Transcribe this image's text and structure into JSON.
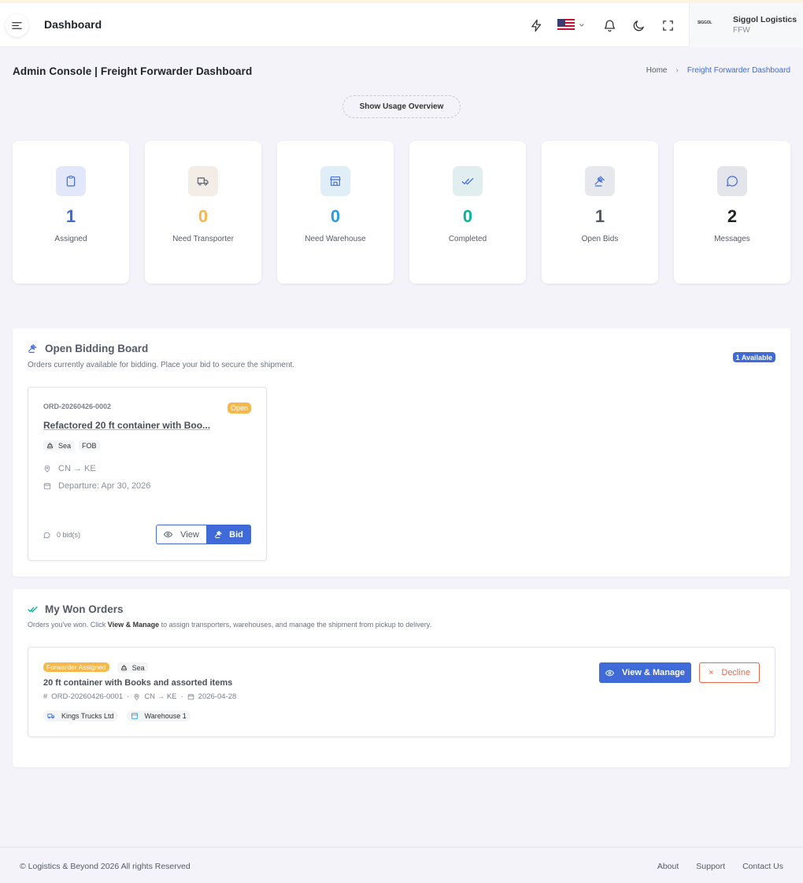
{
  "header": {
    "page_name": "Dashboard",
    "user": {
      "logo_text": "SIGGOL",
      "name": "Siggol Logistics",
      "role": "FFW"
    }
  },
  "title_bar": {
    "title": "Admin Console | Freight Forwarder Dashboard",
    "breadcrumb": {
      "home": "Home",
      "current": "Freight Forwarder Dashboard"
    },
    "usage_button": "Show Usage Overview"
  },
  "stats": [
    {
      "value": "1",
      "label": "Assigned",
      "icon": "clipboard-icon",
      "color": "#3f6ad8",
      "bg": "#e2e8fa"
    },
    {
      "value": "0",
      "label": "Need Transporter",
      "icon": "truck-icon",
      "color": "#f7b84b",
      "bg": "#f4ece6"
    },
    {
      "value": "0",
      "label": "Need Warehouse",
      "icon": "store-icon",
      "color": "#299cdb",
      "bg": "#e0eef8"
    },
    {
      "value": "0",
      "label": "Completed",
      "icon": "double-check-icon",
      "color": "#0ab39c",
      "bg": "#e1eef0"
    },
    {
      "value": "1",
      "label": "Open Bids",
      "icon": "gavel-icon",
      "color": "#555b66",
      "bg": "#e6e8ed"
    },
    {
      "value": "2",
      "label": "Messages",
      "icon": "message-icon",
      "color": "#212529",
      "bg": "#e3e5ea"
    }
  ],
  "bidding_board": {
    "title": "Open Bidding Board",
    "subtitle": "Orders currently available for bidding. Place your bid to secure the shipment.",
    "available_badge": "1 Available",
    "order": {
      "id": "ORD-20260426-0002",
      "status": "Open",
      "title": "Refactored 20 ft container with Boo...",
      "mode": "Sea",
      "incoterm": "FOB",
      "route": "CN → KE",
      "departure": "Departure: Apr 30, 2026",
      "bids": "0 bid(s)",
      "view_label": "View",
      "bid_label": "Bid"
    }
  },
  "won_orders": {
    "title": "My Won Orders",
    "subtitle_pre": "Orders you've won. Click ",
    "subtitle_bold": "View & Manage",
    "subtitle_post": " to assign transporters, warehouses, and manage the shipment from pickup to delivery.",
    "order": {
      "status": "Forwarder Assigned",
      "mode": "Sea",
      "title": "20 ft container with Books and assorted items",
      "id": "ORD-20260426-0001",
      "route": "CN → KE",
      "date": "2026-04-28",
      "transporter": "Kings Trucks Ltd",
      "warehouse": "Warehouse 1",
      "manage_label": "View & Manage",
      "decline_label": "Decline"
    }
  },
  "footer": {
    "copyright": "© Logistics & Beyond 2026 All rights Reserved",
    "links": [
      "About",
      "Support",
      "Contact Us"
    ]
  }
}
